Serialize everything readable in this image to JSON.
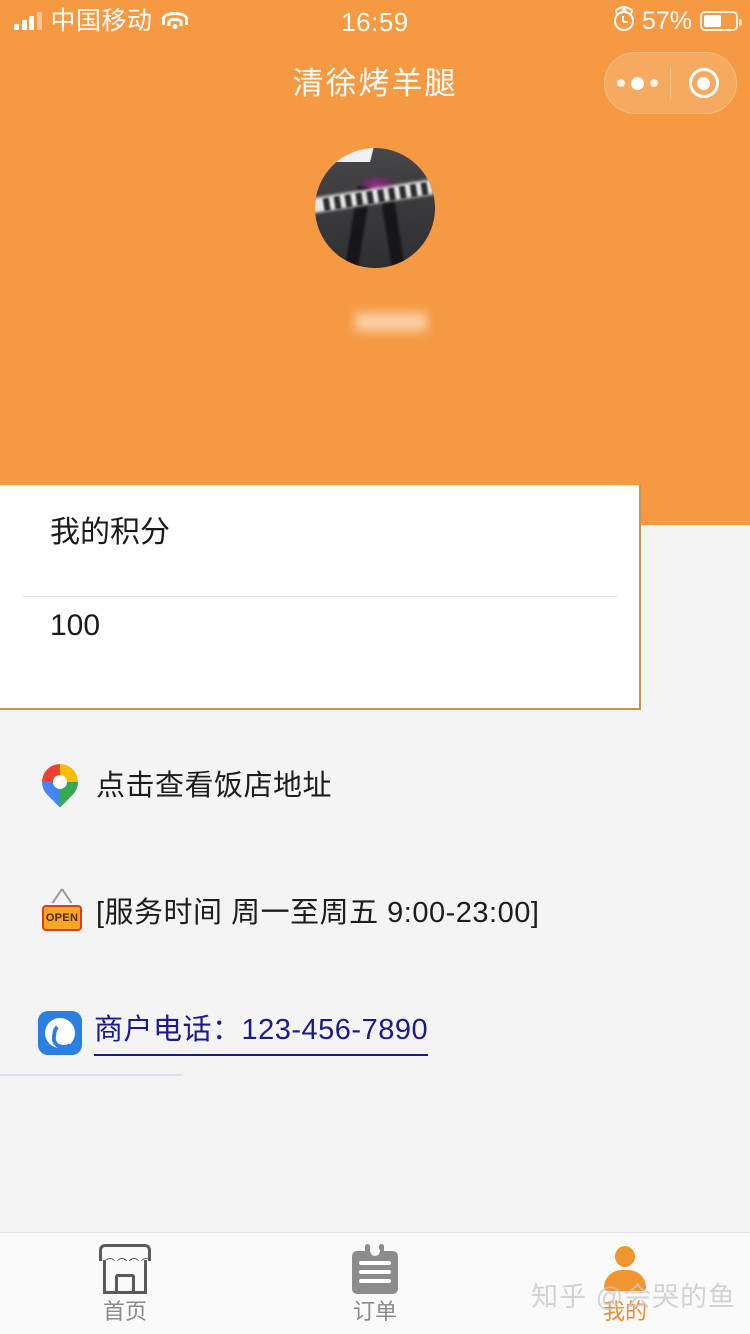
{
  "status_bar": {
    "carrier": "中国移动",
    "time": "16:59",
    "battery_percent": "57%",
    "signal_icon": "signal-bars-icon",
    "wifi_icon": "wifi-icon",
    "alarm_icon": "alarm-clock-icon",
    "battery_icon": "battery-icon"
  },
  "nav": {
    "title": "清徐烤羊腿",
    "capsule": {
      "more_icon": "more-dots-icon",
      "target_icon": "capsule-target-icon"
    }
  },
  "profile": {
    "avatar_icon": "user-avatar",
    "nickname": ""
  },
  "points_card": {
    "title": "我的积分",
    "value": "100"
  },
  "info_rows": [
    {
      "icon": "map-pin-icon",
      "label": "点击查看饭店地址"
    },
    {
      "icon": "open-sign-icon",
      "label": "[服务时间 周一至周五 9:00-23:00]"
    },
    {
      "icon": "phone-icon",
      "label": "商户电话：123-456-7890"
    }
  ],
  "tabbar": {
    "tabs": [
      {
        "icon": "shop-icon",
        "label": "首页"
      },
      {
        "icon": "order-icon",
        "label": "订单"
      },
      {
        "icon": "person-icon",
        "label": "我的"
      }
    ]
  },
  "watermark": "知乎 @会哭的鱼",
  "colors": {
    "brand_orange": "#f59a42",
    "active_tab": "#f08a2e",
    "link_navy": "#1a1a8c",
    "card_border": "#c8954f",
    "page_bg": "#f4f4f5"
  }
}
